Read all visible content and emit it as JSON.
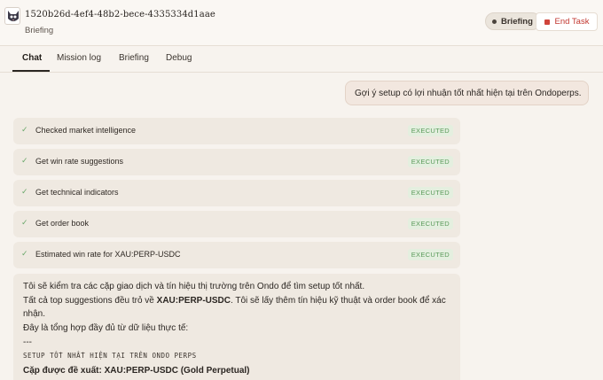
{
  "header": {
    "task_id": "1520b26d-4ef4-48b2-bece-4335334d1aae",
    "subtitle": "Briefing",
    "status_badge": "Briefing",
    "end_task_label": "End Task",
    "accent": "#c2362f"
  },
  "tabs": [
    {
      "label": "Chat",
      "active": true
    },
    {
      "label": "Mission log",
      "active": false
    },
    {
      "label": "Briefing",
      "active": false
    },
    {
      "label": "Debug",
      "active": false
    }
  ],
  "chat": {
    "user_message": "Gợi ý setup có lợi nhuận tốt nhất hiện tại trên Ondoperps.",
    "tool_calls": [
      {
        "label": "Checked market intelligence",
        "status": "EXECUTED"
      },
      {
        "label": "Get win rate suggestions",
        "status": "EXECUTED"
      },
      {
        "label": "Get technical indicators",
        "status": "EXECUTED"
      },
      {
        "label": "Get order book",
        "status": "EXECUTED"
      },
      {
        "label": "Estimated win rate for XAU:PERP-USDC",
        "status": "EXECUTED"
      }
    ],
    "reply": {
      "line1": "Tôi sẽ kiểm tra các cặp giao dịch và tín hiệu thị trường trên Ondo để tìm setup tốt nhất.",
      "line2_pre": "Tất cả top suggestions đều trỏ về ",
      "line2_bold": "XAU:PERP-USDC",
      "line2_post": ". Tôi sẽ lấy thêm tín hiệu kỹ thuật và order book để xác",
      "line2_cont": "nhận.",
      "line3": "Đây là tổng hợp đầy đủ từ dữ liệu thực tế:",
      "line4": "---",
      "line5": "SETUP TỐT NHẤT HIỆN TẠI TRÊN ONDO PERPS",
      "line6": "Cặp được đề xuất: XAU:PERP-USDC (Gold Perpetual)"
    }
  }
}
